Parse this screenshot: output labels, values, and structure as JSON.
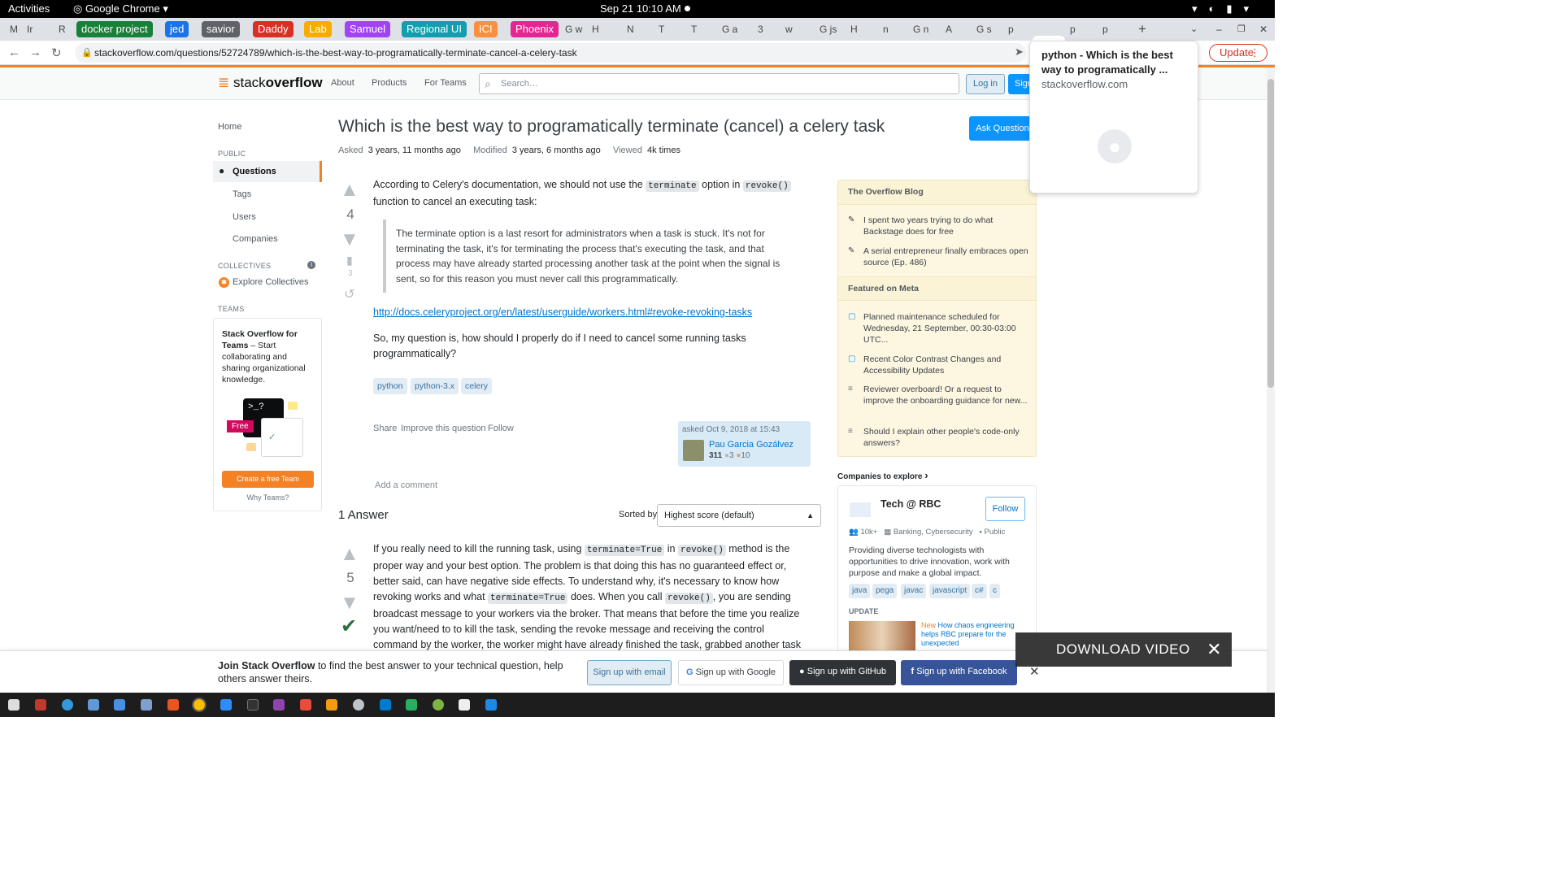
{
  "gnome": {
    "activities": "Activities",
    "app": "Google Chrome",
    "clock": "Sep 21  10:10 AM"
  },
  "tabs": {
    "groups": [
      {
        "label": "docker project",
        "color": "#188038"
      },
      {
        "label": "jed",
        "color": "#1a73e8"
      },
      {
        "label": "savior",
        "color": "#5f6368"
      },
      {
        "label": "Daddy",
        "color": "#d93025"
      },
      {
        "label": "Lab",
        "color": "#f9ab00"
      },
      {
        "label": "Samuel",
        "color": "#a142f4"
      },
      {
        "label": "Regional UI",
        "color": "#129eaf"
      },
      {
        "label": "ICI",
        "color": "#fa903e"
      },
      {
        "label": "Phoenix",
        "color": "#e52592"
      }
    ],
    "first_minis": [
      "M",
      "Ir",
      "R"
    ],
    "minis": [
      "G w",
      "H",
      "N",
      "T",
      "T",
      "G a",
      "3",
      "w",
      "G js",
      "H",
      "n",
      "G n",
      "A",
      "G s",
      "p",
      "p",
      "p"
    ]
  },
  "urlbar": {
    "url": "stackoverflow.com/questions/52724789/which-is-the-best-way-to-programatically-terminate-cancel-a-celery-task",
    "update": "Update"
  },
  "tooltip": {
    "title": "python - Which is the best way to programatically ...",
    "domain": "stackoverflow.com"
  },
  "header": {
    "logo_a": "stack",
    "logo_b": "overflow",
    "nav": [
      "About",
      "Products",
      "For Teams"
    ],
    "search_placeholder": "Search…",
    "login": "Log in",
    "signup": "Sign up"
  },
  "sidebar": {
    "home": "Home",
    "public": "PUBLIC",
    "questions": "Questions",
    "tags": "Tags",
    "users": "Users",
    "companies": "Companies",
    "collectives": "COLLECTIVES",
    "explore": "Explore Collectives",
    "teams": "TEAMS",
    "teams_title": "Stack Overflow for Teams",
    "teams_desc": " – Start collaborating and sharing organizational knowledge.",
    "free": "Free",
    "create": "Create a free Team",
    "why": "Why Teams?"
  },
  "question": {
    "title": "Which is the best way to programatically terminate (cancel) a celery task",
    "ask_button": "Ask Question",
    "asked_label": "Asked",
    "asked_value": "3 years, 11 months ago",
    "modified_label": "Modified",
    "modified_value": "3 years, 6 months ago",
    "viewed_label": "Viewed",
    "viewed_value": "4k times",
    "votes": "4",
    "bookmarks": "3",
    "p1_a": "According to Celery's documentation, we should not use the ",
    "p1_code1": "terminate",
    "p1_b": " option in ",
    "p1_code2": "revoke()",
    "p1_c": " function to cancel an executing task:",
    "quote": "The terminate option is a last resort for administrators when a task is stuck. It's not for terminating the task, it's for terminating the process that's executing the task, and that process may have already started processing another task at the point when the signal is sent, so for this reason you must never call this programmatically.",
    "link": "http://docs.celeryproject.org/en/latest/userguide/workers.html#revoke-revoking-tasks",
    "p2": "So, my question is, how should I properly do if I need to cancel some running tasks programmatically?",
    "tags": [
      "python",
      "python-3.x",
      "celery"
    ],
    "menu": [
      "Share",
      "Improve this question",
      "Follow"
    ],
    "user_asked": "asked Oct 9, 2018 at 15:43",
    "user_name": "Pau Garcia Gozálvez",
    "user_rep": "311",
    "user_silver": "3",
    "user_bronze": "10",
    "add_comment": "Add a comment"
  },
  "answers": {
    "heading": "1 Answer",
    "sorted_label": "Sorted by:",
    "sorted_value": "Highest score (default)",
    "votes": "5",
    "t1": "If you really need to kill the running task, using ",
    "c1": "terminate=True",
    "t2": " in ",
    "c2": "revoke()",
    "t3": " method is the proper way and your best option. The problem is that doing this has no guaranteed effect or, better said, can have negative side effects. To understand why, it's necessary to know how revoking works and what ",
    "c3": "terminate=True",
    "t4": " does. When you call ",
    "c4": "revoke()",
    "t5": ", you are sending broadcast message to your workers via the broker. That means that before the time you realize you want/need to to kill the task, sending the revoke message and receiving the control command by the worker, the worker might have already finished the task, grabbed another task from the queue"
  },
  "rightbar": {
    "blog_head": "The Overflow Blog",
    "blog": [
      "I spent two years trying to do what Backstage does for free",
      "A serial entrepreneur finally embraces open source (Ep. 486)"
    ],
    "meta_head": "Featured on Meta",
    "meta": [
      "Planned maintenance scheduled for Wednesday, 21 September, 00:30-03:00 UTC...",
      "Recent Color Contrast Changes and Accessibility Updates",
      "Reviewer overboard! Or a request to improve the onboarding guidance for new...",
      "Should I explain other people's code-only answers?"
    ],
    "companies_head": "Companies to explore",
    "company_name": "Tech @ RBC",
    "follow": "Follow",
    "size": "10k+",
    "industry": "Banking, Cybersecurity",
    "visibility": "Public",
    "desc": "Providing diverse technologists with opportunities to drive innovation, work with purpose and make a global impact.",
    "tags": [
      "java",
      "pega",
      "javac",
      "javascript",
      "c#",
      "c"
    ],
    "update": "UPDATE",
    "news_new": "New",
    "news": " How chaos engineering helps RBC prepare for the unexpected"
  },
  "join": {
    "bold": "Join Stack Overflow",
    "rest": " to find the best answer to your technical question, help others answer theirs.",
    "email": "Sign up with email",
    "google": "Sign up with Google",
    "github": "Sign up with GitHub",
    "facebook": "Sign up with Facebook"
  },
  "download": "DOWNLOAD VIDEO"
}
